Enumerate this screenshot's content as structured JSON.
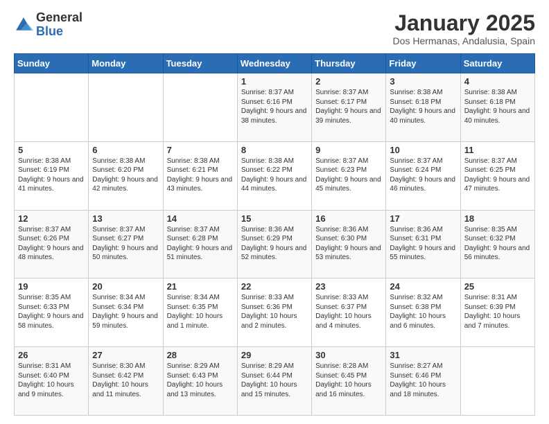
{
  "logo": {
    "general": "General",
    "blue": "Blue"
  },
  "header": {
    "title": "January 2025",
    "location": "Dos Hermanas, Andalusia, Spain"
  },
  "weekdays": [
    "Sunday",
    "Monday",
    "Tuesday",
    "Wednesday",
    "Thursday",
    "Friday",
    "Saturday"
  ],
  "weeks": [
    [
      {
        "day": "",
        "info": ""
      },
      {
        "day": "",
        "info": ""
      },
      {
        "day": "",
        "info": ""
      },
      {
        "day": "1",
        "info": "Sunrise: 8:37 AM\nSunset: 6:16 PM\nDaylight: 9 hours and 38 minutes."
      },
      {
        "day": "2",
        "info": "Sunrise: 8:37 AM\nSunset: 6:17 PM\nDaylight: 9 hours and 39 minutes."
      },
      {
        "day": "3",
        "info": "Sunrise: 8:38 AM\nSunset: 6:18 PM\nDaylight: 9 hours and 40 minutes."
      },
      {
        "day": "4",
        "info": "Sunrise: 8:38 AM\nSunset: 6:18 PM\nDaylight: 9 hours and 40 minutes."
      }
    ],
    [
      {
        "day": "5",
        "info": "Sunrise: 8:38 AM\nSunset: 6:19 PM\nDaylight: 9 hours and 41 minutes."
      },
      {
        "day": "6",
        "info": "Sunrise: 8:38 AM\nSunset: 6:20 PM\nDaylight: 9 hours and 42 minutes."
      },
      {
        "day": "7",
        "info": "Sunrise: 8:38 AM\nSunset: 6:21 PM\nDaylight: 9 hours and 43 minutes."
      },
      {
        "day": "8",
        "info": "Sunrise: 8:38 AM\nSunset: 6:22 PM\nDaylight: 9 hours and 44 minutes."
      },
      {
        "day": "9",
        "info": "Sunrise: 8:37 AM\nSunset: 6:23 PM\nDaylight: 9 hours and 45 minutes."
      },
      {
        "day": "10",
        "info": "Sunrise: 8:37 AM\nSunset: 6:24 PM\nDaylight: 9 hours and 46 minutes."
      },
      {
        "day": "11",
        "info": "Sunrise: 8:37 AM\nSunset: 6:25 PM\nDaylight: 9 hours and 47 minutes."
      }
    ],
    [
      {
        "day": "12",
        "info": "Sunrise: 8:37 AM\nSunset: 6:26 PM\nDaylight: 9 hours and 48 minutes."
      },
      {
        "day": "13",
        "info": "Sunrise: 8:37 AM\nSunset: 6:27 PM\nDaylight: 9 hours and 50 minutes."
      },
      {
        "day": "14",
        "info": "Sunrise: 8:37 AM\nSunset: 6:28 PM\nDaylight: 9 hours and 51 minutes."
      },
      {
        "day": "15",
        "info": "Sunrise: 8:36 AM\nSunset: 6:29 PM\nDaylight: 9 hours and 52 minutes."
      },
      {
        "day": "16",
        "info": "Sunrise: 8:36 AM\nSunset: 6:30 PM\nDaylight: 9 hours and 53 minutes."
      },
      {
        "day": "17",
        "info": "Sunrise: 8:36 AM\nSunset: 6:31 PM\nDaylight: 9 hours and 55 minutes."
      },
      {
        "day": "18",
        "info": "Sunrise: 8:35 AM\nSunset: 6:32 PM\nDaylight: 9 hours and 56 minutes."
      }
    ],
    [
      {
        "day": "19",
        "info": "Sunrise: 8:35 AM\nSunset: 6:33 PM\nDaylight: 9 hours and 58 minutes."
      },
      {
        "day": "20",
        "info": "Sunrise: 8:34 AM\nSunset: 6:34 PM\nDaylight: 9 hours and 59 minutes."
      },
      {
        "day": "21",
        "info": "Sunrise: 8:34 AM\nSunset: 6:35 PM\nDaylight: 10 hours and 1 minute."
      },
      {
        "day": "22",
        "info": "Sunrise: 8:33 AM\nSunset: 6:36 PM\nDaylight: 10 hours and 2 minutes."
      },
      {
        "day": "23",
        "info": "Sunrise: 8:33 AM\nSunset: 6:37 PM\nDaylight: 10 hours and 4 minutes."
      },
      {
        "day": "24",
        "info": "Sunrise: 8:32 AM\nSunset: 6:38 PM\nDaylight: 10 hours and 6 minutes."
      },
      {
        "day": "25",
        "info": "Sunrise: 8:31 AM\nSunset: 6:39 PM\nDaylight: 10 hours and 7 minutes."
      }
    ],
    [
      {
        "day": "26",
        "info": "Sunrise: 8:31 AM\nSunset: 6:40 PM\nDaylight: 10 hours and 9 minutes."
      },
      {
        "day": "27",
        "info": "Sunrise: 8:30 AM\nSunset: 6:42 PM\nDaylight: 10 hours and 11 minutes."
      },
      {
        "day": "28",
        "info": "Sunrise: 8:29 AM\nSunset: 6:43 PM\nDaylight: 10 hours and 13 minutes."
      },
      {
        "day": "29",
        "info": "Sunrise: 8:29 AM\nSunset: 6:44 PM\nDaylight: 10 hours and 15 minutes."
      },
      {
        "day": "30",
        "info": "Sunrise: 8:28 AM\nSunset: 6:45 PM\nDaylight: 10 hours and 16 minutes."
      },
      {
        "day": "31",
        "info": "Sunrise: 8:27 AM\nSunset: 6:46 PM\nDaylight: 10 hours and 18 minutes."
      },
      {
        "day": "",
        "info": ""
      }
    ]
  ]
}
